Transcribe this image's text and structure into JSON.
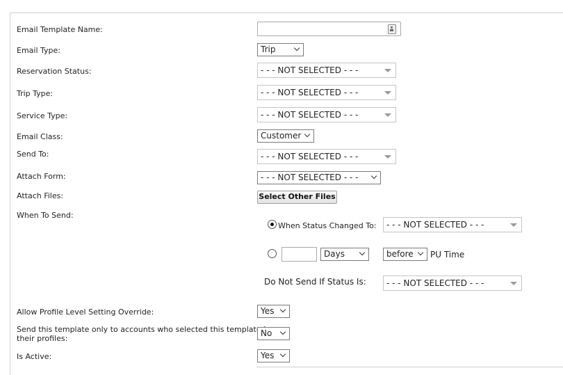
{
  "form": {
    "labels": {
      "template_name": "Email Template Name:",
      "email_type": "Email Type:",
      "reservation_status": "Reservation Status:",
      "trip_type": "Trip Type:",
      "service_type": "Service Type:",
      "email_class": "Email Class:",
      "send_to": "Send To:",
      "attach_form": "Attach Form:",
      "attach_files": "Attach Files:",
      "when_to_send": "When To Send:",
      "allow_override": "Allow Profile Level Setting Override:",
      "send_only_line1": "Send this template only to accounts who selected this template in",
      "send_only_line2": "their profiles:",
      "is_active": "Is Active:"
    },
    "values": {
      "template_name": "",
      "email_type": "Trip",
      "reservation_status": "- - - NOT SELECTED - - -",
      "trip_type": "- - - NOT SELECTED - - -",
      "service_type": "- - - NOT SELECTED - - -",
      "email_class": "Customer",
      "send_to": "- - - NOT SELECTED - - -",
      "attach_form": "- - - NOT SELECTED - - -",
      "allow_override": "Yes",
      "send_only": "No",
      "is_active": "Yes"
    },
    "attach_files_button": "Select Other Files",
    "when_to_send": {
      "status_changed_label": "When Status Changed To:",
      "status_changed_value": "- - - NOT SELECTED - - -",
      "status_changed_selected": true,
      "days_value": "",
      "days_unit": "Days",
      "before_after": "before",
      "pu_time_label": "PU Time",
      "do_not_send_label": "Do Not Send If Status Is:",
      "do_not_send_value": "- - - NOT SELECTED - - -"
    }
  }
}
